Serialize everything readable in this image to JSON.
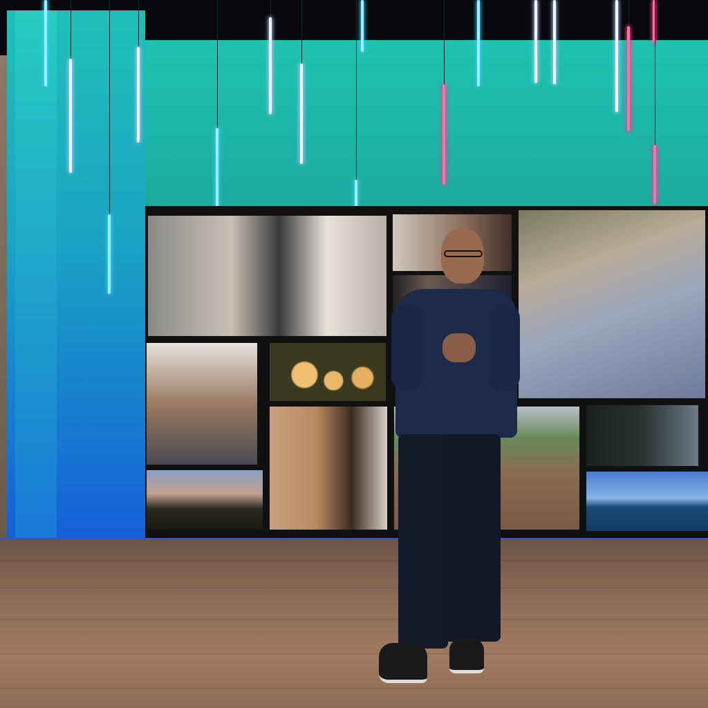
{
  "scene": {
    "colors": {
      "wall_teal": "#1aa69c",
      "panel_blue": "#1560d8",
      "neon_blue": "#8fe8ff",
      "neon_pink": "#ff6fa8",
      "floor_wood": "#8a6a55",
      "shirt_navy": "#1d2a4a",
      "pants_navy": "#141a2a"
    },
    "tubes": [
      {
        "color": "blue",
        "slot": 1
      },
      {
        "color": "white",
        "slot": 2
      },
      {
        "color": "blue",
        "slot": 3
      },
      {
        "color": "white",
        "slot": 4
      },
      {
        "color": "blue",
        "slot": 5
      },
      {
        "color": "white",
        "slot": 6
      },
      {
        "color": "white",
        "slot": 7
      },
      {
        "color": "blue",
        "slot": 8
      },
      {
        "color": "blue",
        "slot": 9
      },
      {
        "color": "pink",
        "slot": 10
      },
      {
        "color": "blue",
        "slot": 11
      },
      {
        "color": "white",
        "slot": 12
      },
      {
        "color": "white",
        "slot": 13
      },
      {
        "color": "white",
        "slot": 14
      },
      {
        "color": "pink",
        "slot": 15
      },
      {
        "color": "pink",
        "slot": 16
      },
      {
        "color": "pink",
        "slot": 17
      }
    ]
  }
}
